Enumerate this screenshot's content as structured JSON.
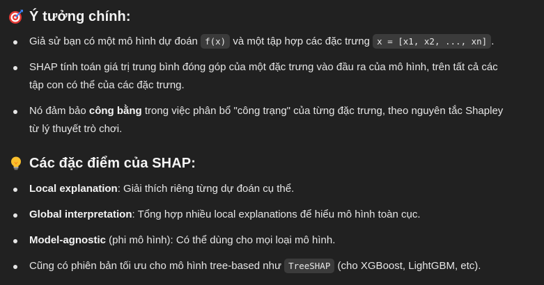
{
  "section1": {
    "icon": "target-icon",
    "heading": "Ý tưởng chính:",
    "bullet1": {
      "pre": "Giả sử bạn có một mô hình dự đoán ",
      "code1": "f(x)",
      "mid": " và một tập hợp các đặc trưng ",
      "code2": "x = [x1, x2, ..., xn]",
      "post": "."
    },
    "bullet2": {
      "line1": "SHAP tính toán giá trị trung bình đóng góp của một đặc trưng vào đầu ra của mô hình, trên tất cả các",
      "line2": "tập con có thể của các đặc trưng."
    },
    "bullet3": {
      "pre": "Nó đảm bảo ",
      "bold": "công bằng",
      "post1": " trong việc phân bổ \"công trạng\" của từng đặc trưng, theo nguyên tắc Shapley",
      "post2": "từ lý thuyết trò chơi."
    }
  },
  "section2": {
    "icon": "lightbulb-icon",
    "heading": "Các đặc điểm của SHAP:",
    "items": [
      {
        "bold": "Local explanation",
        "rest": ": Giải thích riêng từng dự đoán cụ thể."
      },
      {
        "bold": "Global interpretation",
        "rest": ": Tổng hợp nhiều local explanations để hiểu mô hình toàn cục."
      },
      {
        "bold": "Model-agnostic",
        "rest": " (phi mô hình): Có thể dùng cho mọi loại mô hình."
      }
    ],
    "last": {
      "pre": "Cũng có phiên bản tối ưu cho mô hình tree-based như ",
      "code": "TreeSHAP",
      "post": " (cho XGBoost, LightGBM, etc)."
    }
  }
}
